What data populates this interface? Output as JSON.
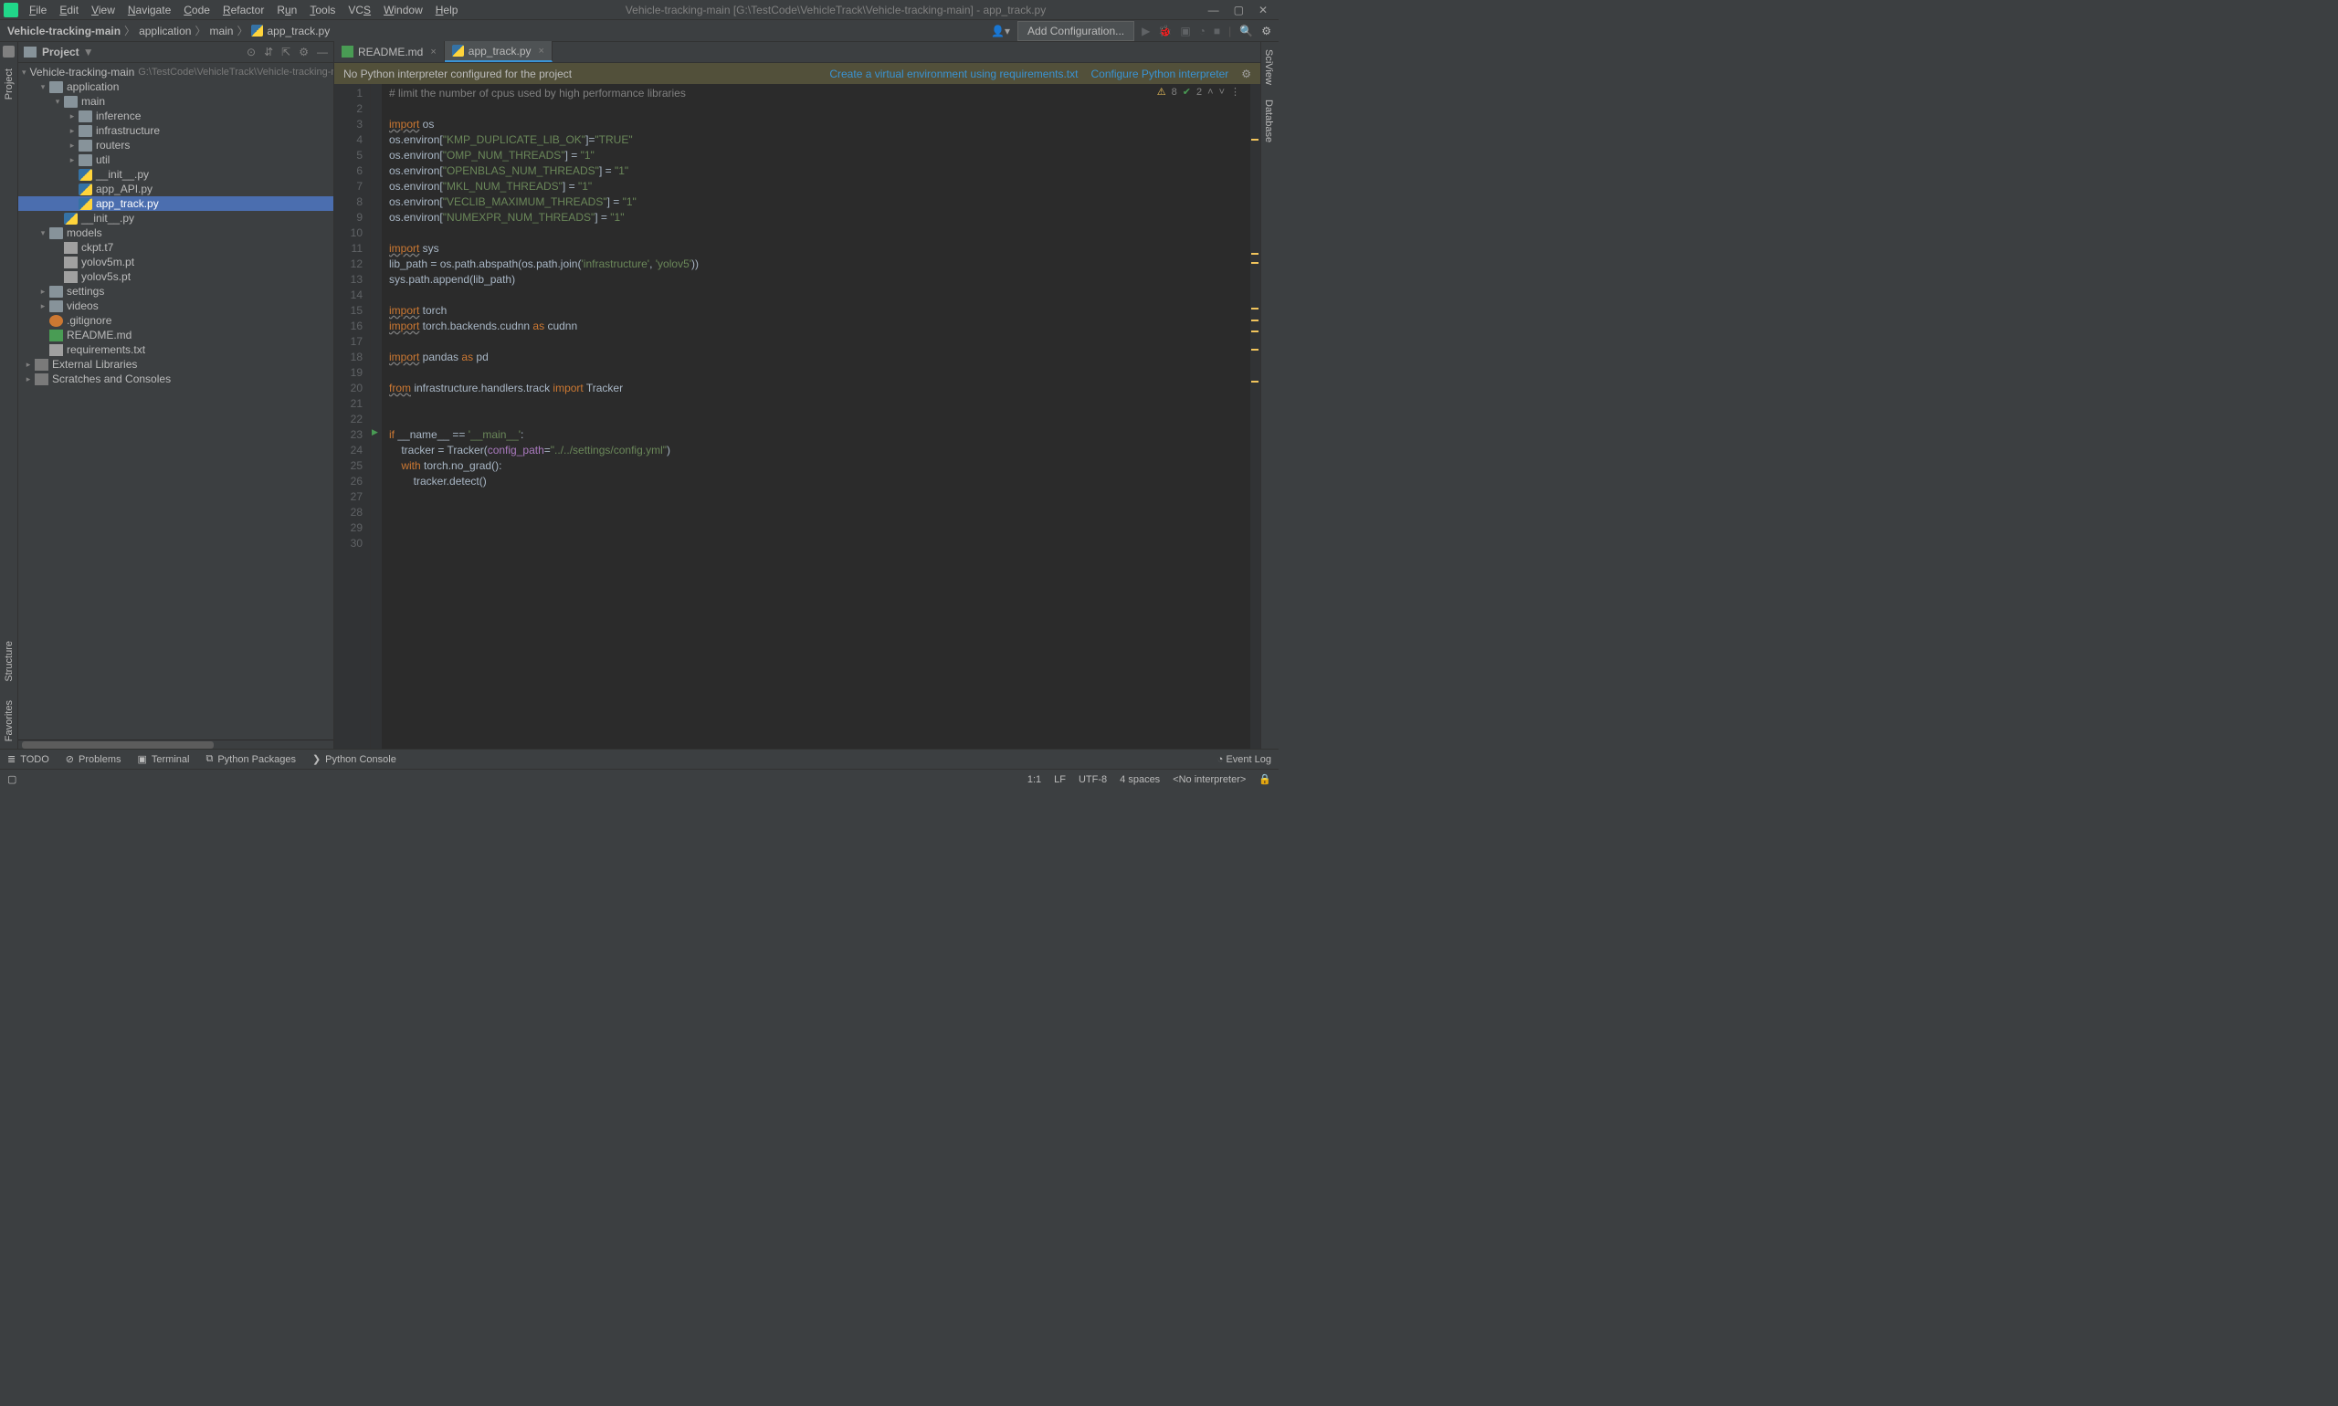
{
  "title": "Vehicle-tracking-main [G:\\TestCode\\VehicleTrack\\Vehicle-tracking-main] - app_track.py",
  "menu": [
    "File",
    "Edit",
    "View",
    "Navigate",
    "Code",
    "Refactor",
    "Run",
    "Tools",
    "VCS",
    "Window",
    "Help"
  ],
  "breadcrumb": [
    "Vehicle-tracking-main",
    "application",
    "main",
    "app_track.py"
  ],
  "nav": {
    "addConfig": "Add Configuration..."
  },
  "projectPanel": {
    "title": "Project"
  },
  "tree": [
    {
      "ind": 0,
      "tog": "▾",
      "ico": "folder",
      "label": "Vehicle-tracking-main",
      "dim": "G:\\TestCode\\VehicleTrack\\Vehicle-tracking-main"
    },
    {
      "ind": 1,
      "tog": "▾",
      "ico": "folder",
      "label": "application"
    },
    {
      "ind": 2,
      "tog": "▾",
      "ico": "folder",
      "label": "main"
    },
    {
      "ind": 3,
      "tog": "▸",
      "ico": "folder",
      "label": "inference"
    },
    {
      "ind": 3,
      "tog": "▸",
      "ico": "folder",
      "label": "infrastructure"
    },
    {
      "ind": 3,
      "tog": "▸",
      "ico": "folder",
      "label": "routers"
    },
    {
      "ind": 3,
      "tog": "▸",
      "ico": "folder",
      "label": "util"
    },
    {
      "ind": 3,
      "tog": "",
      "ico": "py",
      "label": "__init__.py"
    },
    {
      "ind": 3,
      "tog": "",
      "ico": "py",
      "label": "app_API.py"
    },
    {
      "ind": 3,
      "tog": "",
      "ico": "py",
      "label": "app_track.py",
      "sel": true
    },
    {
      "ind": 2,
      "tog": "",
      "ico": "py",
      "label": "__init__.py"
    },
    {
      "ind": 1,
      "tog": "▾",
      "ico": "folder",
      "label": "models"
    },
    {
      "ind": 2,
      "tog": "",
      "ico": "txt",
      "label": "ckpt.t7"
    },
    {
      "ind": 2,
      "tog": "",
      "ico": "txt",
      "label": "yolov5m.pt"
    },
    {
      "ind": 2,
      "tog": "",
      "ico": "txt",
      "label": "yolov5s.pt"
    },
    {
      "ind": 1,
      "tog": "▸",
      "ico": "folder",
      "label": "settings"
    },
    {
      "ind": 1,
      "tog": "▸",
      "ico": "folder",
      "label": "videos"
    },
    {
      "ind": 1,
      "tog": "",
      "ico": "git",
      "label": ".gitignore"
    },
    {
      "ind": 1,
      "tog": "",
      "ico": "md",
      "label": "README.md"
    },
    {
      "ind": 1,
      "tog": "",
      "ico": "txt",
      "label": "requirements.txt"
    },
    {
      "ind": 0,
      "tog": "▸",
      "ico": "lib",
      "label": "External Libraries"
    },
    {
      "ind": 0,
      "tog": "▸",
      "ico": "lib",
      "label": "Scratches and Consoles"
    }
  ],
  "tabs": [
    {
      "label": "README.md",
      "ico": "md",
      "active": false
    },
    {
      "label": "app_track.py",
      "ico": "py",
      "active": true
    }
  ],
  "warning": {
    "text": "No Python interpreter configured for the project",
    "link1": "Create a virtual environment using requirements.txt",
    "link2": "Configure Python interpreter"
  },
  "editorStatus": {
    "warn": "8",
    "check": "2"
  },
  "code": {
    "lines": 30,
    "l1": "# limit the number of cpus used by high performance libraries",
    "l3_import": "import",
    "l3_os": " os",
    "l4_pre": "os.environ[",
    "l4_key": "\"KMP_DUPLICATE_LIB_OK\"",
    "l4_eq": "]=",
    "l4_val": "\"TRUE\"",
    "l5_pre": "os.environ[",
    "l5_key": "\"OMP_NUM_THREADS\"",
    "l5_eq": "] = ",
    "l5_val": "\"1\"",
    "l6_pre": "os.environ[",
    "l6_key": "\"OPENBLAS_NUM_THREADS\"",
    "l6_eq": "] = ",
    "l6_val": "\"1\"",
    "l7_pre": "os.environ[",
    "l7_key": "\"MKL_NUM_THREADS\"",
    "l7_eq": "] = ",
    "l7_val": "\"1\"",
    "l8_pre": "os.environ[",
    "l8_key": "\"VECLIB_MAXIMUM_THREADS\"",
    "l8_eq": "] = ",
    "l8_val": "\"1\"",
    "l9_pre": "os.environ[",
    "l9_key": "\"NUMEXPR_NUM_THREADS\"",
    "l9_eq": "] = ",
    "l9_val": "\"1\"",
    "l11_import": "import",
    "l11_sys": " sys",
    "l12": "lib_path = os.path.abspath(os.path.join(",
    "l12_s1": "'infrastructure'",
    "l12_c": ", ",
    "l12_s2": "'yolov5'",
    "l12_end": "))",
    "l13": "sys.path.append(lib_path)",
    "l15_import": "import",
    "l15_t": " torch",
    "l16_import": "import",
    "l16_a": " torch.backends.cudnn ",
    "l16_as": "as",
    "l16_b": " cudnn",
    "l18_import": "import",
    "l18_a": " pandas ",
    "l18_as": "as",
    "l18_b": " pd",
    "l20_from": "from",
    "l20_a": " infrastructure.handlers.track ",
    "l20_import": "import",
    "l20_b": " Tracker",
    "l23_if": "if ",
    "l23_a": "__name__ == ",
    "l23_s": "'__main__'",
    "l23_c": ":",
    "l24_a": "    tracker = Tracker(",
    "l24_p": "config_path",
    "l24_e": "=",
    "l24_s": "\"../../settings/config.yml\"",
    "l24_end": ")",
    "l25_a": "    ",
    "l25_with": "with",
    "l25_b": " torch.no_grad():",
    "l26": "        tracker.detect()"
  },
  "bottomBar": [
    "TODO",
    "Problems",
    "Terminal",
    "Python Packages",
    "Python Console"
  ],
  "bottomRight": "Event Log",
  "statusBar": {
    "pos": "1:1",
    "lf": "LF",
    "enc": "UTF-8",
    "indent": "4 spaces",
    "interp": "<No interpreter>"
  },
  "leftTools": [
    "Project",
    "Structure",
    "Favorites"
  ],
  "rightTools": [
    "SciView",
    "Database"
  ]
}
